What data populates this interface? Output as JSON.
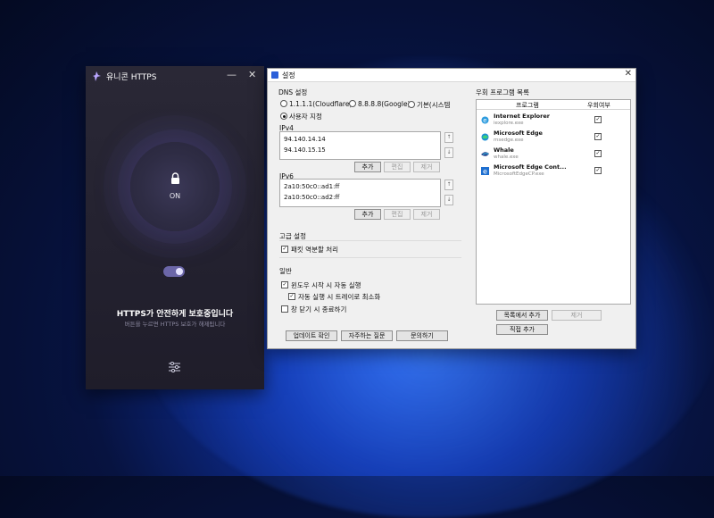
{
  "app": {
    "title": "유니콘 HTTPS",
    "minimize": "—",
    "close": "✕",
    "lock_state": "ON",
    "status_main": "HTTPS가 안전하게 보호중입니다",
    "status_sub": "버튼을 누르면 HTTPS 보호가 해제됩니다",
    "accent": "#6b66a8"
  },
  "dialog": {
    "title": "설정",
    "close": "✕",
    "dns": {
      "heading": "DNS 설정",
      "options": [
        "1.1.1.1(Cloudflare)",
        "8.8.8.8(Google)",
        "기본(시스템"
      ],
      "custom": "사용자 지정",
      "ipv4_label": "IPv4",
      "ipv4_values": [
        "94.140.14.14",
        "94.140.15.15"
      ],
      "ipv6_label": "IPv6",
      "ipv6_values": [
        "2a10:50c0::ad1:ff",
        "2a10:50c0::ad2:ff"
      ],
      "add": "추가",
      "edit": "편집",
      "remove": "제거"
    },
    "advanced": {
      "heading": "고급 설정",
      "packet": "패킷 역분할 처리"
    },
    "general": {
      "heading": "일반",
      "autostart": "윈도우 시작 시 자동 실행",
      "tray": "자동 실행 시 트레이로 최소화",
      "exit_on_close": "창 닫기 시 종료하기"
    },
    "footer": {
      "update": "업데이트 확인",
      "faq": "자주하는 질문",
      "contact": "문의하기"
    },
    "bypass": {
      "heading": "우회 프로그램 목록",
      "col_program": "프로그램",
      "col_bypass": "우회여부",
      "items": [
        {
          "name": "Internet Explorer",
          "exe": "iexplore.exe",
          "icon": "internet-explorer-icon",
          "checked": true
        },
        {
          "name": "Microsoft Edge",
          "exe": "msedge.exe",
          "icon": "edge-icon",
          "checked": true
        },
        {
          "name": "Whale",
          "exe": "whale.exe",
          "icon": "whale-icon",
          "checked": true
        },
        {
          "name": "Microsoft Edge Cont...",
          "exe": "MicrosoftEdgeCP.exe",
          "icon": "edge-legacy-icon",
          "checked": true
        }
      ],
      "add_from_list": "목록에서 추가",
      "remove": "제거",
      "add_direct": "직접 추가"
    }
  }
}
